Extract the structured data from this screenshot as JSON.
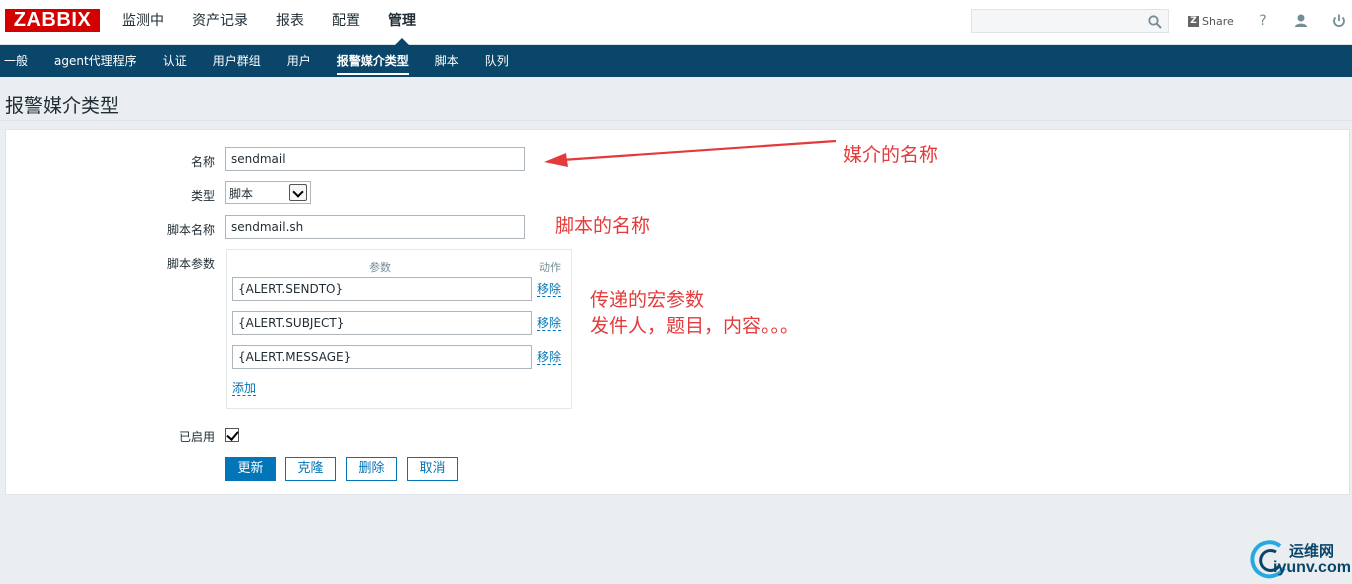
{
  "brand": {
    "logo_text": "ZABBIX",
    "color": "#d40000"
  },
  "main_menu": [
    {
      "label": "监测中",
      "active": false
    },
    {
      "label": "资产记录",
      "active": false
    },
    {
      "label": "报表",
      "active": false
    },
    {
      "label": "配置",
      "active": false
    },
    {
      "label": "管理",
      "active": true
    }
  ],
  "header": {
    "search_placeholder": "",
    "share_label": "Share",
    "share_badge": "Z",
    "help_glyph": "?"
  },
  "sub_menu": [
    {
      "label": "一般",
      "active": false
    },
    {
      "label": "agent代理程序",
      "active": false
    },
    {
      "label": "认证",
      "active": false
    },
    {
      "label": "用户群组",
      "active": false
    },
    {
      "label": "用户",
      "active": false
    },
    {
      "label": "报警媒介类型",
      "active": true
    },
    {
      "label": "脚本",
      "active": false
    },
    {
      "label": "队列",
      "active": false
    }
  ],
  "page": {
    "title": "报警媒介类型"
  },
  "form": {
    "name_label": "名称",
    "name_value": "sendmail",
    "type_label": "类型",
    "type_value": "脚本",
    "script_name_label": "脚本名称",
    "script_name_value": "sendmail.sh",
    "params_label": "脚本参数",
    "params_header_param": "参数",
    "params_header_action": "动作",
    "params": [
      {
        "value": "{ALERT.SENDTO}",
        "remove": "移除"
      },
      {
        "value": "{ALERT.SUBJECT}",
        "remove": "移除"
      },
      {
        "value": "{ALERT.MESSAGE}",
        "remove": "移除"
      }
    ],
    "add_label": "添加",
    "enabled_label": "已启用",
    "enabled": true
  },
  "buttons": {
    "update": "更新",
    "clone": "克隆",
    "delete": "删除",
    "cancel": "取消"
  },
  "annotations": {
    "media_name": "媒介的名称",
    "script_name": "脚本的名称",
    "macro_line1": "传递的宏参数",
    "macro_line2": "发件人，题目，内容。。。",
    "color": "#e33b3b"
  },
  "watermark": {
    "line1": "运维网",
    "line2": "iyunv.com"
  },
  "colors": {
    "nav_bg": "#0a466a",
    "link": "#0275b8",
    "page_bg": "#ebeef0"
  }
}
